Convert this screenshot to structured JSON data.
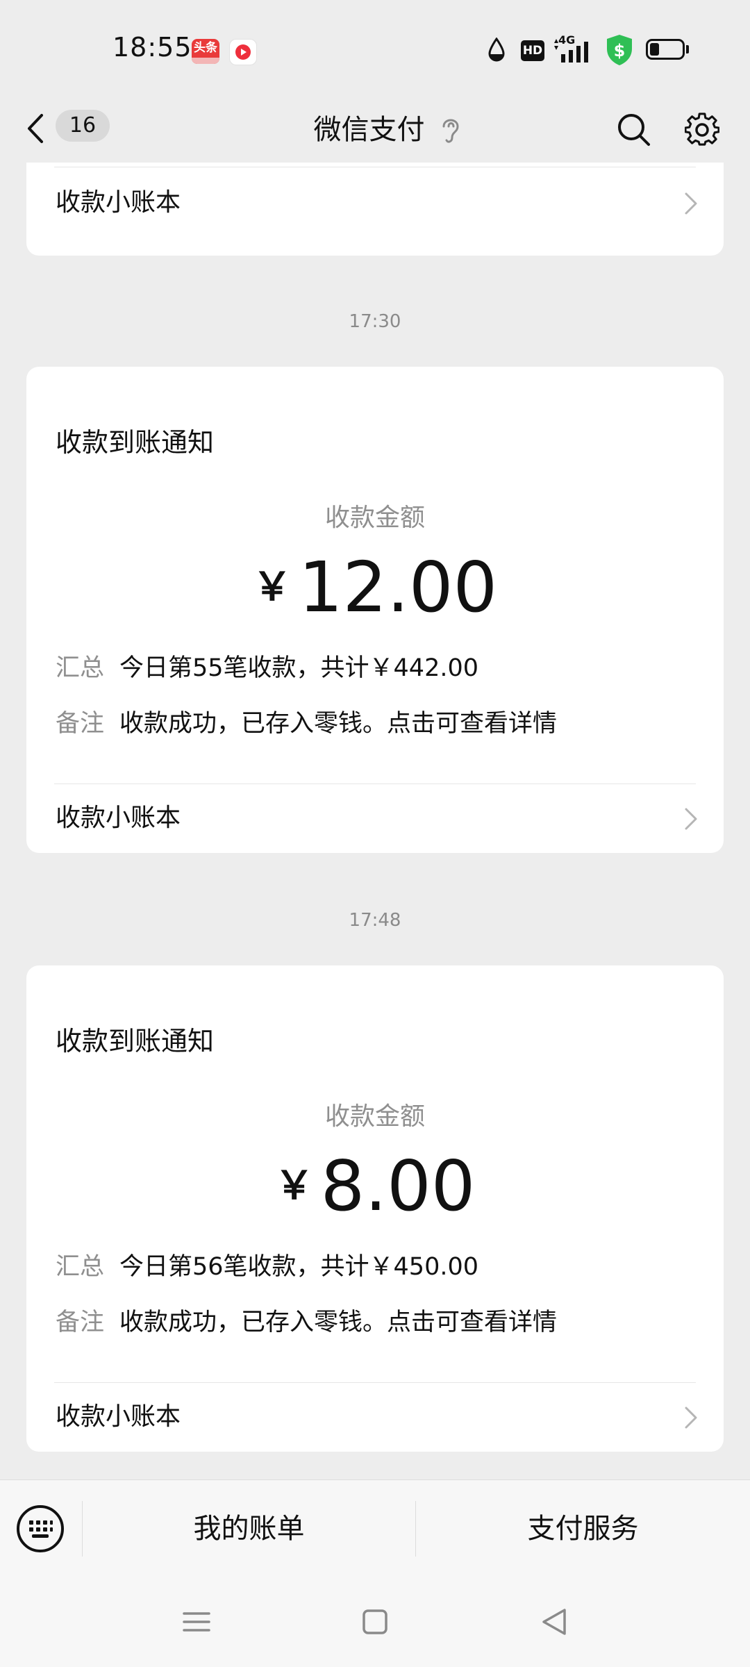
{
  "status_bar": {
    "time": "18:55",
    "toutiao_badge": "头条",
    "hd_label": "HD",
    "network": "4G",
    "icons": [
      "toutiao-app-icon",
      "video-app-icon",
      "water-drop-icon",
      "hd-icon",
      "signal-4g-icon",
      "security-shield-icon",
      "battery-icon"
    ],
    "battery_level": 0.3,
    "colors": {
      "shield": "#2fbf55",
      "toutiao": "#e93a3a",
      "video": "#ee2f3c"
    }
  },
  "nav": {
    "back_icon": "chevron-left-icon",
    "unread_count": "16",
    "title": "微信支付",
    "ear_icon": "ear-icon",
    "search_icon": "search-icon",
    "settings_icon": "gear-icon"
  },
  "messages": [
    {
      "partial": true,
      "ledger_label": "收款小账本"
    },
    {
      "timestamp": "17:30",
      "title": "收款到账通知",
      "amount_label": "收款金额",
      "currency": "￥",
      "amount": "12.00",
      "summary_key": "汇总",
      "summary_value": "今日第55笔收款，共计￥442.00",
      "note_key": "备注",
      "note_value": "收款成功，已存入零钱。点击可查看详情",
      "ledger_label": "收款小账本"
    },
    {
      "timestamp": "17:48",
      "title": "收款到账通知",
      "amount_label": "收款金额",
      "currency": "￥",
      "amount": "8.00",
      "summary_key": "汇总",
      "summary_value": "今日第56笔收款，共计￥450.00",
      "note_key": "备注",
      "note_value": "收款成功，已存入零钱。点击可查看详情",
      "ledger_label": "收款小账本"
    }
  ],
  "menu": {
    "keyboard_icon": "keyboard-icon",
    "items": [
      {
        "label": "我的账单"
      },
      {
        "label": "支付服务"
      }
    ]
  },
  "system_nav": {
    "icons": [
      "menu-lines-icon",
      "home-square-icon",
      "back-triangle-icon"
    ]
  }
}
